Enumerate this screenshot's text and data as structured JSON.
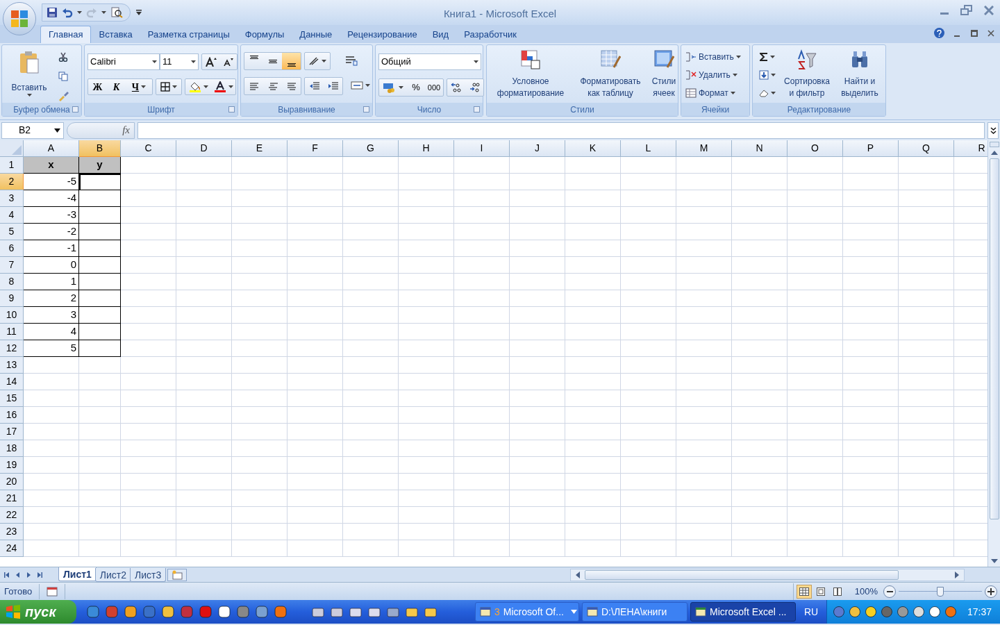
{
  "window": {
    "title": "Книга1 - Microsoft Excel"
  },
  "tabs": [
    {
      "label": "Главная",
      "selected": true
    },
    {
      "label": "Вставка",
      "selected": false
    },
    {
      "label": "Разметка страницы",
      "selected": false
    },
    {
      "label": "Формулы",
      "selected": false
    },
    {
      "label": "Данные",
      "selected": false
    },
    {
      "label": "Рецензирование",
      "selected": false
    },
    {
      "label": "Вид",
      "selected": false
    },
    {
      "label": "Разработчик",
      "selected": false
    }
  ],
  "ribbon": {
    "clipboard": {
      "label": "Буфер обмена",
      "paste": "Вставить"
    },
    "font": {
      "label": "Шрифт",
      "font_name": "Calibri",
      "font_size": "11",
      "bold": "Ж",
      "italic": "К",
      "underline": "Ч"
    },
    "alignment": {
      "label": "Выравнивание",
      "vertical_align": [
        {
          "kind": "top",
          "selected": false
        },
        {
          "kind": "middle",
          "selected": false
        },
        {
          "kind": "bottom",
          "selected": true
        }
      ]
    },
    "number": {
      "label": "Число",
      "format": "Общий",
      "percent": "%",
      "thousands": "000"
    },
    "styles": {
      "label": "Стили",
      "buttons": [
        {
          "lines": [
            "Условное",
            "форматирование"
          ]
        },
        {
          "lines": [
            "Форматировать",
            "как таблицу"
          ]
        },
        {
          "lines": [
            "Стили",
            "ячеек"
          ]
        }
      ]
    },
    "cells": {
      "label": "Ячейки",
      "buttons": [
        "Вставить",
        "Удалить",
        "Формат"
      ]
    },
    "editing": {
      "label": "Редактирование",
      "buttons": [
        {
          "lines": [
            "Сортировка",
            "и фильтр"
          ]
        },
        {
          "lines": [
            "Найти и",
            "выделить"
          ]
        }
      ]
    }
  },
  "formula_bar": {
    "name_box": "B2",
    "function_label": "fx"
  },
  "sheet": {
    "columns": [
      {
        "label": "A",
        "selected": false
      },
      {
        "label": "B",
        "selected": true
      },
      {
        "label": "C",
        "selected": false
      },
      {
        "label": "D",
        "selected": false
      },
      {
        "label": "E",
        "selected": false
      },
      {
        "label": "F",
        "selected": false
      },
      {
        "label": "G",
        "selected": false
      },
      {
        "label": "H",
        "selected": false
      },
      {
        "label": "I",
        "selected": false
      },
      {
        "label": "J",
        "selected": false
      },
      {
        "label": "K",
        "selected": false
      },
      {
        "label": "L",
        "selected": false
      },
      {
        "label": "M",
        "selected": false
      },
      {
        "label": "N",
        "selected": false
      },
      {
        "label": "O",
        "selected": false
      },
      {
        "label": "P",
        "selected": false
      },
      {
        "label": "Q",
        "selected": false
      },
      {
        "label": "R",
        "selected": false
      }
    ],
    "rows": [
      {
        "label": "1",
        "selected": false,
        "cells": [
          {
            "text": "x",
            "kind": "header",
            "selected": false
          },
          {
            "text": "y",
            "kind": "header",
            "selected": false
          }
        ]
      },
      {
        "label": "2",
        "selected": true,
        "cells": [
          {
            "text": "-5",
            "kind": "number",
            "selected": false
          },
          {
            "kind": "number",
            "selected": true
          }
        ]
      },
      {
        "label": "3",
        "selected": false,
        "cells": [
          {
            "text": "-4",
            "kind": "number",
            "selected": false
          },
          {
            "kind": "number",
            "selected": false
          }
        ]
      },
      {
        "label": "4",
        "selected": false,
        "cells": [
          {
            "text": "-3",
            "kind": "number",
            "selected": false
          },
          {
            "kind": "number",
            "selected": false
          }
        ]
      },
      {
        "label": "5",
        "selected": false,
        "cells": [
          {
            "text": "-2",
            "kind": "number",
            "selected": false
          },
          {
            "kind": "number",
            "selected": false
          }
        ]
      },
      {
        "label": "6",
        "selected": false,
        "cells": [
          {
            "text": "-1",
            "kind": "number",
            "selected": false
          },
          {
            "kind": "number",
            "selected": false
          }
        ]
      },
      {
        "label": "7",
        "selected": false,
        "cells": [
          {
            "text": "0",
            "kind": "number",
            "selected": false
          },
          {
            "kind": "number",
            "selected": false
          }
        ]
      },
      {
        "label": "8",
        "selected": false,
        "cells": [
          {
            "text": "1",
            "kind": "number",
            "selected": false
          },
          {
            "kind": "number",
            "selected": false
          }
        ]
      },
      {
        "label": "9",
        "selected": false,
        "cells": [
          {
            "text": "2",
            "kind": "number",
            "selected": false
          },
          {
            "kind": "number",
            "selected": false
          }
        ]
      },
      {
        "label": "10",
        "selected": false,
        "cells": [
          {
            "text": "3",
            "kind": "number",
            "selected": false
          },
          {
            "kind": "number",
            "selected": false
          }
        ]
      },
      {
        "label": "11",
        "selected": false,
        "cells": [
          {
            "text": "4",
            "kind": "number",
            "selected": false
          },
          {
            "kind": "number",
            "selected": false
          }
        ]
      },
      {
        "label": "12",
        "selected": false,
        "cells": [
          {
            "text": "5",
            "kind": "number",
            "selected": false
          },
          {
            "kind": "number",
            "selected": false
          }
        ]
      },
      {
        "label": "13",
        "selected": false
      },
      {
        "label": "14",
        "selected": false
      },
      {
        "label": "15",
        "selected": false
      },
      {
        "label": "16",
        "selected": false
      },
      {
        "label": "17",
        "selected": false
      },
      {
        "label": "18",
        "selected": false
      },
      {
        "label": "19",
        "selected": false
      },
      {
        "label": "20",
        "selected": false
      },
      {
        "label": "21",
        "selected": false
      },
      {
        "label": "22",
        "selected": false
      },
      {
        "label": "23",
        "selected": false
      },
      {
        "label": "24",
        "selected": false
      }
    ]
  },
  "sheet_tabs": [
    {
      "label": "Лист1",
      "selected": true
    },
    {
      "label": "Лист2",
      "selected": false
    },
    {
      "label": "Лист3",
      "selected": false
    }
  ],
  "status_bar": {
    "status": "Готово",
    "zoom": "100%",
    "zoom_slider": {
      "level": 0.5
    }
  },
  "taskbar": {
    "start": "пуск",
    "tasks": [
      {
        "count": "3",
        "label": "Microsoft Of...",
        "selected": false
      },
      {
        "label": "D:\\ЛЕНА\\книги",
        "selected": false
      },
      {
        "label": "Microsoft Excel ...",
        "selected": true
      }
    ],
    "language": "RU",
    "clock": "17:37"
  }
}
